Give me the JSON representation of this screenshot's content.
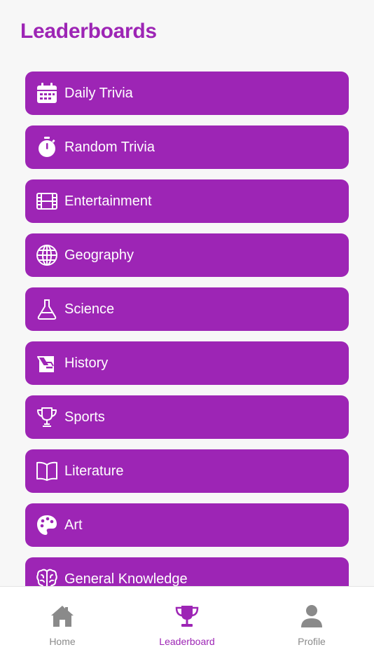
{
  "header": {
    "title": "Leaderboards"
  },
  "categories": [
    {
      "label": "Daily Trivia",
      "icon": "calendar-icon"
    },
    {
      "label": "Random Trivia",
      "icon": "stopwatch-icon"
    },
    {
      "label": "Entertainment",
      "icon": "film-icon"
    },
    {
      "label": "Geography",
      "icon": "globe-icon"
    },
    {
      "label": "Science",
      "icon": "flask-icon"
    },
    {
      "label": "History",
      "icon": "scroll-icon"
    },
    {
      "label": "Sports",
      "icon": "trophy-icon"
    },
    {
      "label": "Literature",
      "icon": "book-icon"
    },
    {
      "label": "Art",
      "icon": "palette-icon"
    },
    {
      "label": "General Knowledge",
      "icon": "brain-icon"
    }
  ],
  "tabbar": {
    "tabs": [
      {
        "label": "Home",
        "icon": "home-icon",
        "active": false
      },
      {
        "label": "Leaderboard",
        "icon": "trophy-icon",
        "active": true
      },
      {
        "label": "Profile",
        "icon": "person-icon",
        "active": false
      }
    ]
  },
  "colors": {
    "accent": "#9d25b5",
    "inactive_tab": "#8a8a8a",
    "background": "#f7f7f7"
  }
}
